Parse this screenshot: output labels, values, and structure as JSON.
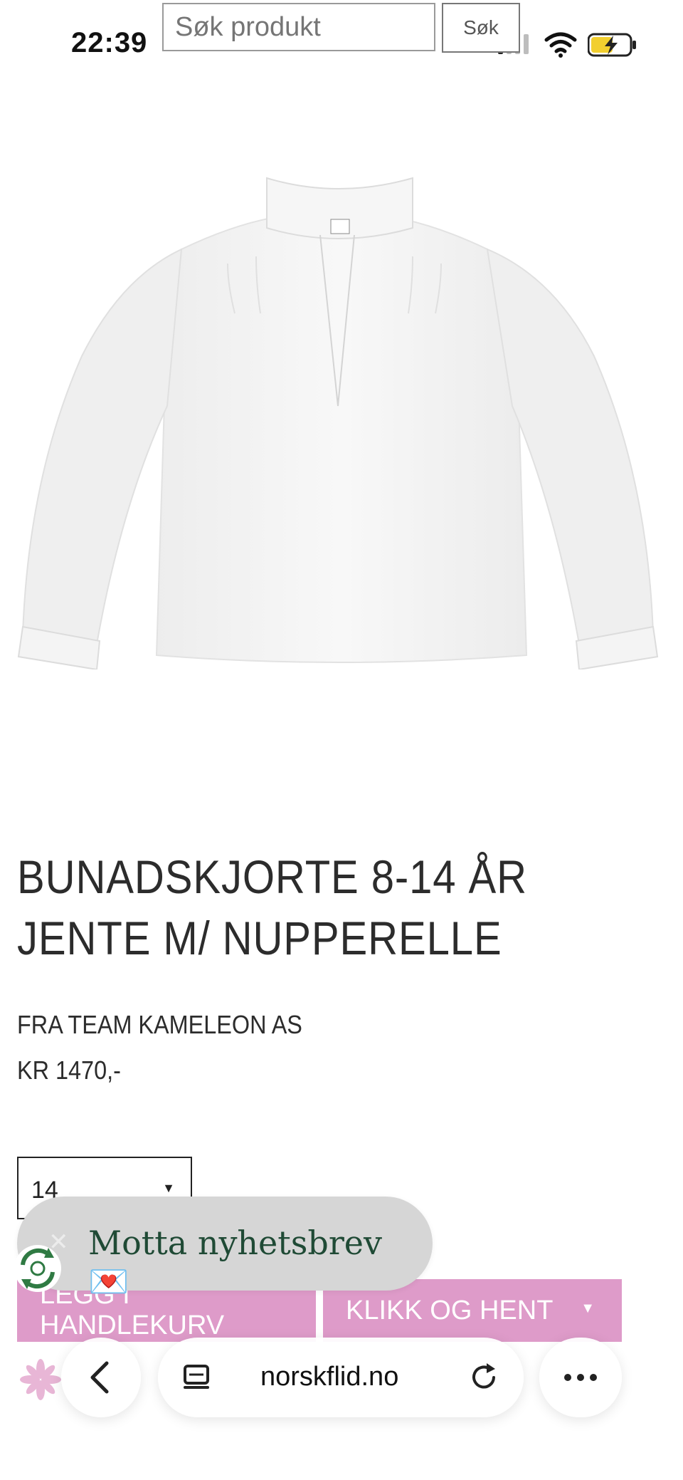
{
  "status_bar": {
    "time": "22:39"
  },
  "search": {
    "placeholder": "Søk produkt",
    "button_label": "Søk"
  },
  "product": {
    "image_icon": "white-blouse-photo",
    "title": "BUNADSKJORTE 8-14 ÅR JENTE M/ NUPPERELLE",
    "vendor": "FRA TEAM KAMELEON AS",
    "price": "KR 1470,-",
    "size_selected": "14"
  },
  "actions": {
    "add_to_cart": "LEGG I HANDLEKURV",
    "click_collect": "KLIKK OG HENT"
  },
  "newsletter": {
    "label": "Motta nyhetsbrev 💌",
    "close_icon": "close-icon"
  },
  "browser": {
    "url": "norskflid.no",
    "back_icon": "chevron-left-icon",
    "tabs_icon": "tabs-icon",
    "reload_icon": "reload-icon",
    "more_icon": "more-icon"
  },
  "colors": {
    "accent_pink": "#de9bc9",
    "newsletter_bg": "#d6d6d6",
    "newsletter_text": "#1f4a35"
  }
}
